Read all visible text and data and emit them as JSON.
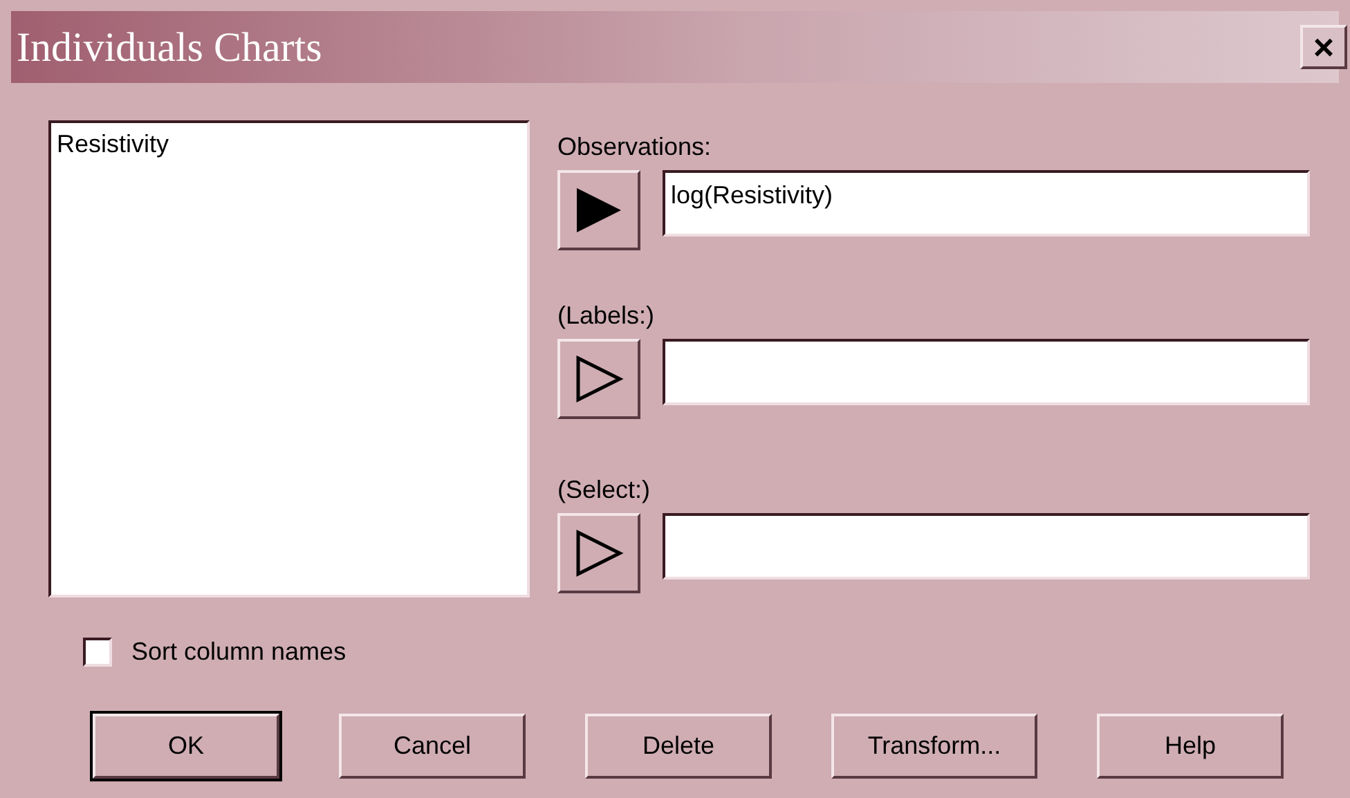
{
  "window": {
    "title": "Individuals Charts",
    "close": "×"
  },
  "variables": [
    "Resistivity"
  ],
  "fields": [
    {
      "label": "Observations:",
      "value": "log(Resistivity)",
      "filled": true
    },
    {
      "label": "(Labels:)",
      "filled": false
    },
    {
      "label": "(Select:)",
      "filled": false
    }
  ],
  "sort_checkbox": {
    "label": "Sort column names",
    "checked": false
  },
  "buttons": [
    {
      "label": "OK",
      "default": true
    },
    {
      "label": "Cancel",
      "default": false
    },
    {
      "label": "Delete",
      "default": false
    },
    {
      "label": "Transform...",
      "default": false
    },
    {
      "label": "Help",
      "default": false
    }
  ]
}
